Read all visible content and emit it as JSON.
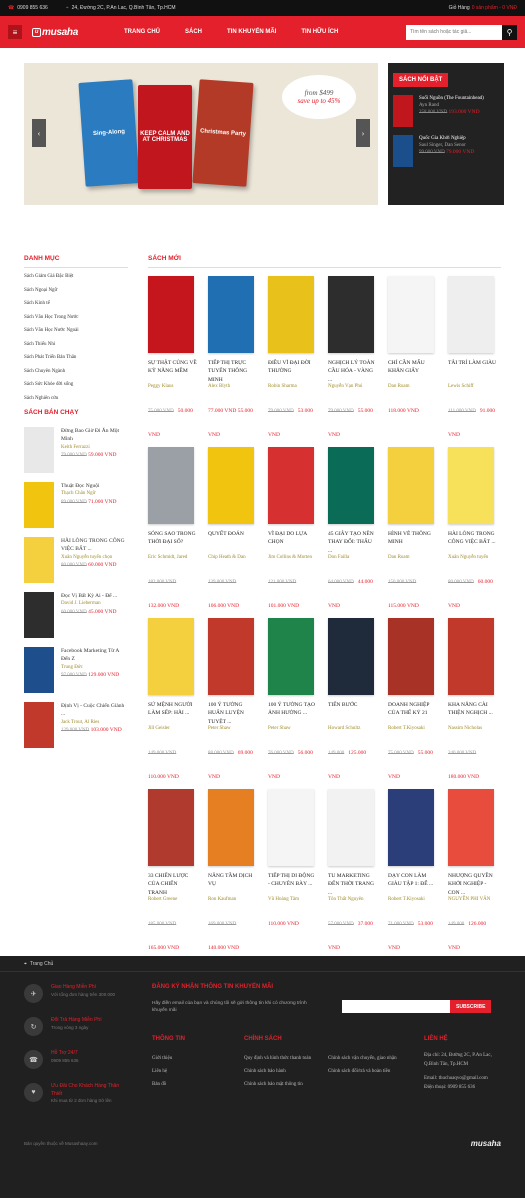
{
  "topbar": {
    "phone": "0909 855 636",
    "address": "24, Đường 2C, P.An Lac, Q.Bình Tân, Tp.HCM",
    "cart_label": "Giỏ Hàng",
    "cart_value": "0 sản phẩm - 0 VNĐ"
  },
  "nav": {
    "logo": "musaha",
    "links": [
      "TRANG CHỦ",
      "SÁCH",
      "TIN KHUYẾN MÃI",
      "TIN HỮU ÍCH"
    ],
    "search_placeholder": "Tìm tên sách hoặc tác giả..."
  },
  "slider": {
    "books": [
      "Sing-Along",
      "KEEP CALM AND AT CHRISTMAS",
      "Christmas Party"
    ],
    "price_from": "from $499",
    "price_to": "save up to 45%"
  },
  "featured": {
    "title": "SÁCH NỔI BẬT",
    "items": [
      {
        "title": "Suối Nguồn (The Fountainhead)",
        "author": "Ayn Rand",
        "old": "258.000 VND",
        "new": "193.000 VND"
      },
      {
        "title": "Quốc Gia Khởi Nghiệp",
        "author": "Saul Singer, Dan Senor",
        "old": "99.000 VND",
        "new": "79.000 VND"
      }
    ]
  },
  "categories": {
    "title": "DANH MỤC",
    "items": [
      "Sách Giảm Giá Đặc Biệt",
      "Sách Ngoại Ngữ",
      "Sách Kinh tế",
      "Sách Văn Học Trong Nước",
      "Sách Văn Học Nước Ngoài",
      "Sách Thiếu Nhi",
      "Sách Phát Triển Bản Thân",
      "Sách Chuyên Ngành",
      "Sách Sức Khỏe đời sống",
      "Sách Nghiên cứu"
    ]
  },
  "bestsellers": {
    "title": "SÁCH BÁN CHẠY",
    "items": [
      {
        "title": "Đừng Bao Giờ Đi Ăn Một Mình",
        "author": "Keith Ferrazzi",
        "old": "79.000 VND",
        "new": "59.000 VND"
      },
      {
        "title": "Thuật Đọc Nguội",
        "author": "Thạch Chân Ngữ",
        "old": "89.000 VND",
        "new": "71.000 VND"
      },
      {
        "title": "HÃI LÒNG TRONG CÔNG VIỆC BẤT ...",
        "author": "Xuân Nguyễn tuyển chọn",
        "old": "80.000 VND",
        "new": "60.000 VND"
      },
      {
        "title": "Đọc Vị Bất Kỳ Ai - Để ...",
        "author": "David J. Lieberman",
        "old": "60.000 VND",
        "new": "45.000 VND"
      },
      {
        "title": "Facebook Marketing Từ A Đến Z",
        "author": "Trung Đức",
        "old": "97.000 VND",
        "new": "129.000 VND"
      },
      {
        "title": "Định Vị - Cuộc Chiến Giành ...",
        "author": "Jack Trout, Al Ries",
        "old": "129.000 VND",
        "new": "103.000 VND"
      }
    ]
  },
  "new_books": {
    "title": "SÁCH MỚI",
    "items": [
      {
        "title": "SỰ THẬT CÚNG VỀ KỸ NĂNG MỀM",
        "author": "Peggy Klaus",
        "old": "75.000 VND",
        "new": "50.000 VND"
      },
      {
        "title": "TIẾP THỊ TRỰC TUYẾN THÔNG MINH",
        "author": "Alex Blyth",
        "old": "",
        "new": "77.000 VND 55.000 VND"
      },
      {
        "title": "ĐIỀU VĨ ĐẠI ĐỜI THƯỜNG",
        "author": "Robin Sharma",
        "old": "79.000 VND",
        "new": "53.000 VND"
      },
      {
        "title": "NGHỊCH LÝ TOÀN CẦU HÓA - VÀNG ...",
        "author": "Nguyễn Vạn Phú",
        "old": "79.000 VND",
        "new": "55.000 VND"
      },
      {
        "title": "CHÍ CẦN MẨU KHĂN GIẤY",
        "author": "Dan Roam",
        "old": "",
        "new": "118.000 VND"
      },
      {
        "title": "TÂI TRÍ LÀM GIÀU",
        "author": "Lewis Schiff",
        "old": "111.000 VND",
        "new": "91.000 VND"
      },
      {
        "title": "SÓNG SAO TRONG THỜI ĐẠI SỐ?",
        "author": "Eric Schmidt, Jared",
        "old": "182.000 VND",
        "new": "132.000 VND"
      },
      {
        "title": "QUYẾT ĐOÁN",
        "author": "Chip Heath & Dan",
        "old": "139.000 VND",
        "new": "106.000 VND"
      },
      {
        "title": "VĨ ĐẠI DO LỰA CHỌN",
        "author": "Jim Collins & Morten",
        "old": "121.000 VND",
        "new": "101.000 VND"
      },
      {
        "title": "45 GIÂY TẠO NÊN THAY ĐỔI: THẤU ...",
        "author": "Don Failla",
        "old": "64.000 VND",
        "new": "44.000 VND"
      },
      {
        "title": "HÌNH VẼ THÔNG MINH",
        "author": "Dan Roam",
        "old": "150.000 VND",
        "new": "115.000 VND"
      },
      {
        "title": "HÀI LÒNG TRONG CÔNG VIỆC BẤT ...",
        "author": "Xuân Nguyễn tuyển",
        "old": "80.000 VND",
        "new": "60.000 VND"
      },
      {
        "title": "SỨ MỆNH NGƯỜI LÀM SẾP: HÃI ...",
        "author": "Jill Geisler",
        "old": "149.000 VND",
        "new": "110.000 VND"
      },
      {
        "title": "100 Ý TƯỞNG HUẤN LUYỆN TUYỆT ...",
        "author": "Peter Shaw",
        "old": "88.000 VND",
        "new": "69.000 VND"
      },
      {
        "title": "100 Ý TƯỞNG TẠO ẢNH HƯỞNG ...",
        "author": "Peter Shaw",
        "old": "76.000 VND",
        "new": "56.000 VND"
      },
      {
        "title": "TIẾN BƯỚC",
        "author": "Howard Schultz",
        "old": "149.000",
        "new": "125.000 VND"
      },
      {
        "title": "DOANH NGHIỆP CỦA THẾ KỶ 21",
        "author": "Robert T.Kiyosaki",
        "old": "75.000 VND",
        "new": "55.000 VND"
      },
      {
        "title": "KHA NĂNG CÀI THIỆN NGHỊCH ...",
        "author": "Nassim Nicholas",
        "old": "240.000 VND",
        "new": "180.000 VND"
      },
      {
        "title": "33 CHIẾN LƯỢC CỦA CHIẾN TRANH",
        "author": "Robert Greene",
        "old": "185.000 VND",
        "new": "165.000 VND"
      },
      {
        "title": "NÂNG TẦM DỊCH VỤ",
        "author": "Ron Kaufman",
        "old": "169.000 VND",
        "new": "140.000 VND"
      },
      {
        "title": "TIẾP THỊ DI ĐỘNG - CHUYÊN BÀY ...",
        "author": "Vũ Hoàng Tâm",
        "old": "",
        "new": "110.000 VND"
      },
      {
        "title": "TU MARKETING ĐẾN THỜI TRANG ...",
        "author": "Tôn Thất Nguyên",
        "old": "57.000 VND",
        "new": "37.000 VND"
      },
      {
        "title": "DẠY CON LÀM GIÀU TẬP 1: ĐỂ ...",
        "author": "Robert T.Kiyosaki",
        "old": "71.000 VND",
        "new": "53.000 VND"
      },
      {
        "title": "NHƯỢNG QUYỀN KHỞI NGHIỆP - CON ...",
        "author": "NGUYỄN PHI VÂN",
        "old": "149.000",
        "new": "126.000 VND"
      }
    ]
  },
  "footer": {
    "breadcrumb": "Trang Chủ",
    "features": [
      {
        "title": "Giao Hàng Miễn Phí",
        "sub": "Với tổng đơn hàng trên 300.000"
      },
      {
        "title": "Đổi Trả Hàng Miễn Phí",
        "sub": "Trong vòng 3 ngày"
      },
      {
        "title": "Hỗ Trợ 24/7",
        "sub": "0909 855 636"
      },
      {
        "title": "Ưu Đãi Cho Khách Hàng Thân Thiết",
        "sub": "Khi mua từ 2 đơn hàng trở lên"
      }
    ],
    "newsletter_title": "ĐĂNG KÝ NHẬN THÔNG TIN KHUYẾN MÃI",
    "newsletter_text": "Hãy điền email của bạn và chúng tôi sẽ gửi thông tin khi có chương trình khuyến mãi",
    "subscribe": "SUBSCRIBE",
    "info_title": "THÔNG TIN",
    "info_links": [
      "Giới thiệu",
      "Liên hệ",
      "Bản đồ"
    ],
    "policy_title": "CHÍNH SÁCH",
    "policy_col1": [
      "Quy định và hình thức thanh toán",
      "Chính sách bảo hành",
      "Chính sách bảo mật thông tin"
    ],
    "policy_col2": [
      "Chính sách vận chuyển, giao nhận",
      "Chính sách đổi/trả và hoàn tiền"
    ],
    "contact_title": "LIÊN HỆ",
    "contact_address": "Địa chỉ: 24, Đường 2C, P.An Lac, Q.Bình Tân, Tp.HCM",
    "contact_email": "Email: thuchuaqvo@gmail.com",
    "contact_phone": "Điện thoại: 0909 855 636",
    "copyright": "Bản quyền thuộc về Musashaay.com",
    "logo": "musaha"
  }
}
